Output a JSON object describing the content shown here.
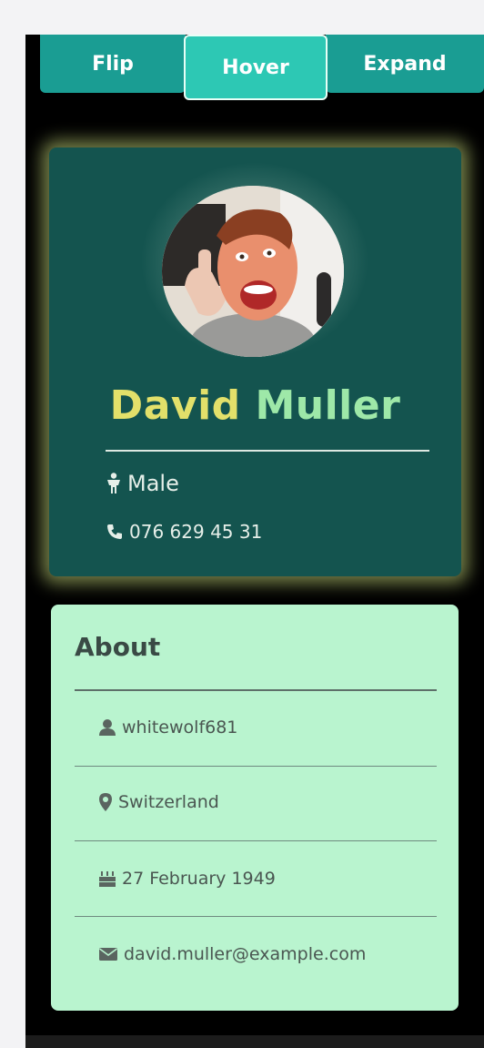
{
  "tabs": {
    "flip": "Flip",
    "hover": "Hover",
    "expand": "Expand"
  },
  "profile": {
    "first_name": "David",
    "last_name": "Muller",
    "gender": "Male",
    "phone": "076 629 45 31"
  },
  "about": {
    "title": "About",
    "username": "whitewolf681",
    "location": "Switzerland",
    "birthday": "27 February 1949",
    "email": "david.muller@example.com"
  },
  "colors": {
    "tab": "#1a9d93",
    "tab_active": "#2dc8b4",
    "card": "#14544f",
    "card_glow": "#d2e682",
    "first_name": "#e3e06a",
    "last_name": "#9ee8a8",
    "about_bg": "#b9f4cf"
  },
  "icons": {
    "gender": "male-person-icon",
    "phone": "phone-icon",
    "username": "user-icon",
    "location": "map-marker-icon",
    "birthday": "birthday-cake-icon",
    "email": "envelope-icon"
  }
}
